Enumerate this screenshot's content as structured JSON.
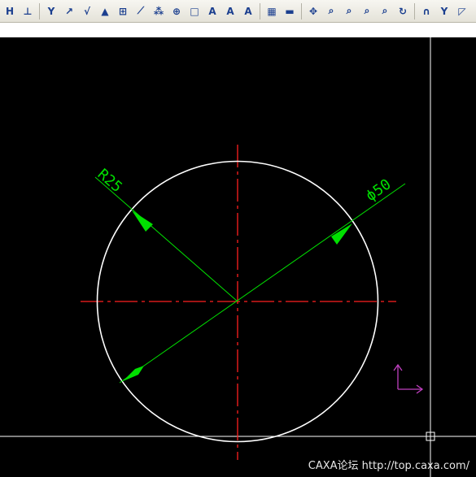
{
  "toolbar": {
    "buttons": [
      {
        "name": "h-dim-tool-icon",
        "glyph": "H"
      },
      {
        "name": "base-dim-tool-icon",
        "glyph": "⊥"
      },
      {
        "sep": true
      },
      {
        "name": "curve-tool-icon",
        "glyph": "Y"
      },
      {
        "name": "arc-text-tool-icon",
        "glyph": "↗"
      },
      {
        "name": "roughness-tool-icon",
        "glyph": "√"
      },
      {
        "name": "datum-tool-icon",
        "glyph": "▲"
      },
      {
        "name": "tolerance-frame-tool-icon",
        "glyph": "⊞"
      },
      {
        "name": "leader-tool-icon",
        "glyph": "⟋"
      },
      {
        "name": "hatch-tool-icon",
        "glyph": "⁂"
      },
      {
        "name": "center-tool-icon",
        "glyph": "⊕"
      },
      {
        "name": "block-tool-icon",
        "glyph": "□"
      },
      {
        "name": "text-up-tool-icon",
        "glyph": "A"
      },
      {
        "name": "text-frame-tool-icon",
        "glyph": "A"
      },
      {
        "name": "text-align-tool-icon",
        "glyph": "A"
      },
      {
        "sep": true
      },
      {
        "name": "table-tool-icon",
        "glyph": "▦"
      },
      {
        "name": "ruler-tool-icon",
        "glyph": "▬"
      },
      {
        "sep": true
      },
      {
        "name": "pan-tool-icon",
        "glyph": "✥"
      },
      {
        "name": "zoom-tool-icon",
        "glyph": "⌕"
      },
      {
        "name": "zoom-window-tool-icon",
        "glyph": "⌕"
      },
      {
        "name": "zoom-all-tool-icon",
        "glyph": "⌕"
      },
      {
        "name": "zoom-previous-tool-icon",
        "glyph": "⌕"
      },
      {
        "name": "refresh-tool-icon",
        "glyph": "↻"
      },
      {
        "sep": true
      },
      {
        "name": "magnet-tool-icon",
        "glyph": "∩"
      },
      {
        "name": "snap-tool-icon",
        "glyph": "Y"
      },
      {
        "name": "triangle-tool-icon",
        "glyph": "◸"
      }
    ]
  },
  "drawing": {
    "radius_label": "R25",
    "diameter_label": "ϕ50"
  },
  "colors": {
    "background": "#000000",
    "circle": "#ffffff",
    "centerline": "#ff2020",
    "dimension": "#00e000",
    "ucs": "#c040c0",
    "crosshair": "#ffffff"
  },
  "watermark": "CAXA论坛 http://top.caxa.com/"
}
